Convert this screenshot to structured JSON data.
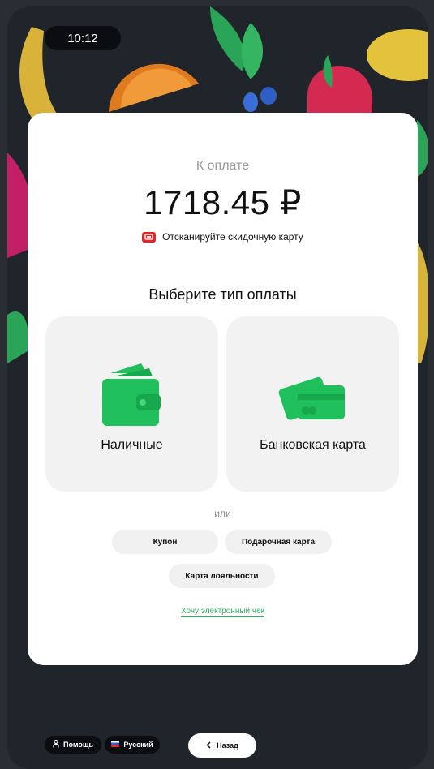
{
  "status": {
    "time": "10:12"
  },
  "payment": {
    "due_label": "К оплате",
    "amount": "1718.45 ₽",
    "scan_text": "Отсканируйте скидочную карту",
    "choose_title": "Выберите тип оплаты",
    "methods": [
      {
        "label": "Наличные",
        "icon": "wallet-icon"
      },
      {
        "label": "Банковская карта",
        "icon": "bank-cards-icon"
      }
    ],
    "or_label": "или",
    "options": [
      {
        "label": "Купон"
      },
      {
        "label": "Подарочная карта"
      },
      {
        "label": "Карта лояльности"
      }
    ],
    "ereceipt_link": "Хочу электронный чек"
  },
  "footer": {
    "help_label": "Помощь",
    "language_label": "Русский",
    "back_label": "Назад"
  },
  "colors": {
    "accent_green": "#1fbf5b",
    "link_green": "#2db25d",
    "scan_red": "#e3262a",
    "background": "#1f252b",
    "card": "#ffffff",
    "tile": "#f2f2f2"
  }
}
